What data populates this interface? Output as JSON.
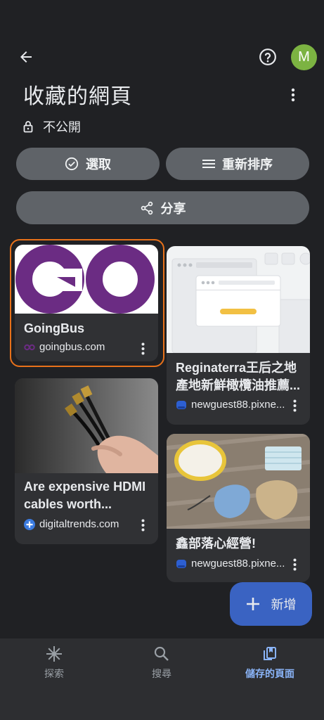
{
  "header": {
    "title": "收藏的網頁",
    "privacy_label": "不公開",
    "avatar_letter": "M",
    "avatar_color": "#7cb342"
  },
  "actions": {
    "select_label": "選取",
    "reorder_label": "重新排序",
    "share_label": "分享"
  },
  "cards": [
    {
      "title": "GoingBus",
      "source": "goingbus.com",
      "logo_text": "GO",
      "selected": true,
      "accent": "#e8711a"
    },
    {
      "title": "Reginaterra王后之地產地新鮮橄欖油推薦...",
      "source": "newguest88.pixne..."
    },
    {
      "title": "Are expensive HDMI cables worth...",
      "source": "digitaltrends.com"
    },
    {
      "title": "鑫部落心經營!",
      "source": "newguest88.pixne..."
    }
  ],
  "fab": {
    "label": "新增"
  },
  "nav": {
    "items": [
      {
        "label": "探索",
        "icon": "asterisk-icon",
        "active": false
      },
      {
        "label": "搜尋",
        "icon": "search-icon",
        "active": false
      },
      {
        "label": "儲存的頁面",
        "icon": "collections-icon",
        "active": true
      }
    ]
  },
  "colors": {
    "background": "#202124",
    "card": "#303134",
    "pill": "#5f6368",
    "fab": "#3a63c2",
    "active_nav": "#8ab4f8"
  }
}
